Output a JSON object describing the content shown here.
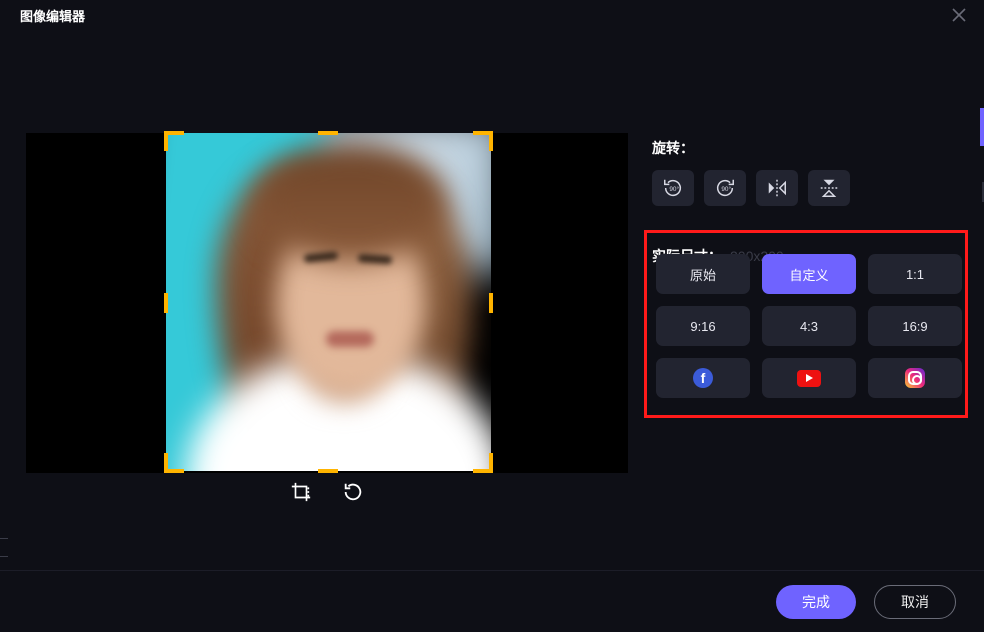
{
  "window": {
    "title": "图像编辑器"
  },
  "rotate": {
    "label": "旋转：",
    "deg": "90°"
  },
  "size": {
    "label": "实际尺寸：",
    "value": "200x200"
  },
  "ratios": {
    "original": "原始",
    "custom": "自定义",
    "r11": "1:1",
    "r916": "9:16",
    "r43": "4:3",
    "r169": "16:9"
  },
  "footer": {
    "done": "完成",
    "cancel": "取消"
  },
  "icons": {
    "fb": "f"
  }
}
